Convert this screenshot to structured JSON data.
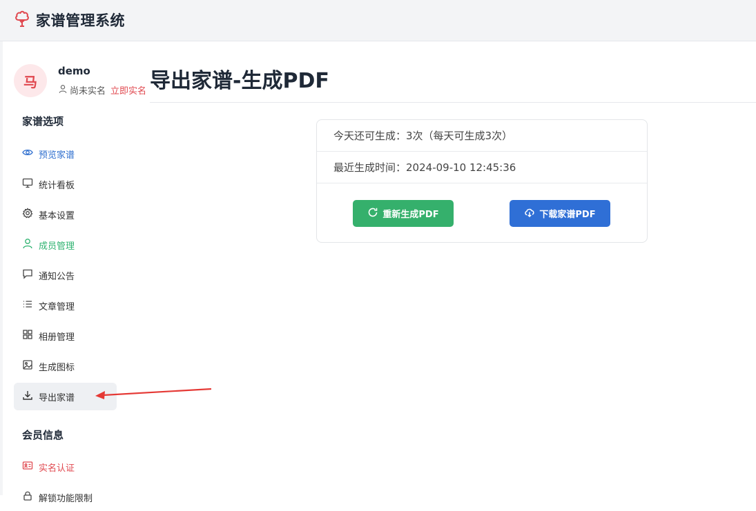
{
  "header": {
    "app_title": "家谱管理系统",
    "logo_icon": "tree-icon",
    "accent": "#e0484f"
  },
  "user": {
    "avatar_text": "马",
    "name": "demo",
    "verify_status": "尚未实名",
    "verify_link": "立即实名"
  },
  "sidebar": {
    "section1_title": "家谱选项",
    "items": [
      {
        "label": "预览家谱",
        "icon": "eye-icon"
      },
      {
        "label": "统计看板",
        "icon": "monitor-icon"
      },
      {
        "label": "基本设置",
        "icon": "gear-icon"
      },
      {
        "label": "成员管理",
        "icon": "user-icon"
      },
      {
        "label": "通知公告",
        "icon": "message-icon"
      },
      {
        "label": "文章管理",
        "icon": "list-icon"
      },
      {
        "label": "相册管理",
        "icon": "grid-icon"
      },
      {
        "label": "生成图标",
        "icon": "image-icon"
      },
      {
        "label": "导出家谱",
        "icon": "download-icon",
        "active": true
      }
    ],
    "section2_title": "会员信息",
    "items2": [
      {
        "label": "实名认证",
        "icon": "id-card-icon"
      },
      {
        "label": "解锁功能限制",
        "icon": "lock-icon"
      }
    ]
  },
  "main": {
    "title": "导出家谱-生成PDF",
    "remaining_label": "今天还可生成：",
    "remaining_value": "3次（每天可生成3次）",
    "last_label": "最近生成时间：",
    "last_value": "2024-09-10 12:45:36",
    "regen_button": "重新生成PDF",
    "download_button": "下载家谱PDF"
  },
  "colors": {
    "green": "#35b06c",
    "blue": "#2f6fd6",
    "red": "#e0484f"
  }
}
